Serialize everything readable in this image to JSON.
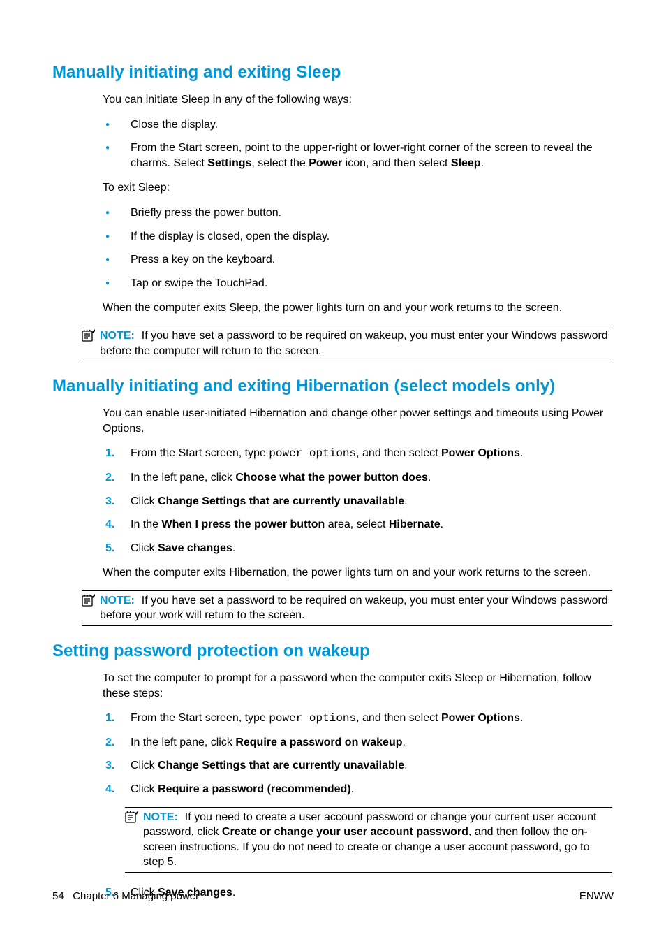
{
  "section1": {
    "heading": "Manually initiating and exiting Sleep",
    "intro": "You can initiate Sleep in any of the following ways:",
    "b1": "Close the display.",
    "b2a": "From the Start screen, point to the upper-right or lower-right corner of the screen to reveal the charms. Select ",
    "b2_settings": "Settings",
    "b2b": ", select the ",
    "b2_power": "Power",
    "b2c": " icon, and then select ",
    "b2_sleep": "Sleep",
    "b2d": ".",
    "exit_intro": "To exit Sleep:",
    "e1": "Briefly press the power button.",
    "e2": "If the display is closed, open the display.",
    "e3": "Press a key on the keyboard.",
    "e4": "Tap or swipe the TouchPad.",
    "exit_outro": "When the computer exits Sleep, the power lights turn on and your work returns to the screen.",
    "note_label": "NOTE:",
    "note_text": "If you have set a password to be required on wakeup, you must enter your Windows password before the computer will return to the screen."
  },
  "section2": {
    "heading": "Manually initiating and exiting Hibernation (select models only)",
    "intro": "You can enable user-initiated Hibernation and change other power settings and timeouts using Power Options.",
    "s1a": "From the Start screen, type ",
    "s1_code": "power options",
    "s1b": ", and then select ",
    "s1_bold": "Power Options",
    "s1c": ".",
    "s2a": "In the left pane, click ",
    "s2_bold": "Choose what the power button does",
    "s2b": ".",
    "s3a": "Click ",
    "s3_bold": "Change Settings that are currently unavailable",
    "s3b": ".",
    "s4a": "In the ",
    "s4_bold1": "When I press the power button",
    "s4b": " area, select ",
    "s4_bold2": "Hibernate",
    "s4c": ".",
    "s5a": "Click ",
    "s5_bold": "Save changes",
    "s5b": ".",
    "outro": "When the computer exits Hibernation, the power lights turn on and your work returns to the screen.",
    "note_label": "NOTE:",
    "note_text": "If you have set a password to be required on wakeup, you must enter your Windows password before your work will return to the screen."
  },
  "section3": {
    "heading": "Setting password protection on wakeup",
    "intro": "To set the computer to prompt for a password when the computer exits Sleep or Hibernation, follow these steps:",
    "s1a": "From the Start screen, type ",
    "s1_code": "power options",
    "s1b": ", and then select ",
    "s1_bold": "Power Options",
    "s1c": ".",
    "s2a": "In the left pane, click ",
    "s2_bold": "Require a password on wakeup",
    "s2b": ".",
    "s3a": "Click ",
    "s3_bold": "Change Settings that are currently unavailable",
    "s3b": ".",
    "s4a": "Click ",
    "s4_bold": "Require a password (recommended)",
    "s4b": ".",
    "note_label": "NOTE:",
    "note_a": "If you need to create a user account password or change your current user account password, click ",
    "note_bold": "Create or change your user account password",
    "note_b": ", and then follow the on-screen instructions. If you do not need to create or change a user account password, go to step 5.",
    "s5a": "Click ",
    "s5_bold": "Save changes",
    "s5b": "."
  },
  "footer": {
    "page_num": "54",
    "chapter": "Chapter 6   Managing power",
    "right": "ENWW"
  },
  "nums": {
    "1": "1.",
    "2": "2.",
    "3": "3.",
    "4": "4.",
    "5": "5."
  }
}
